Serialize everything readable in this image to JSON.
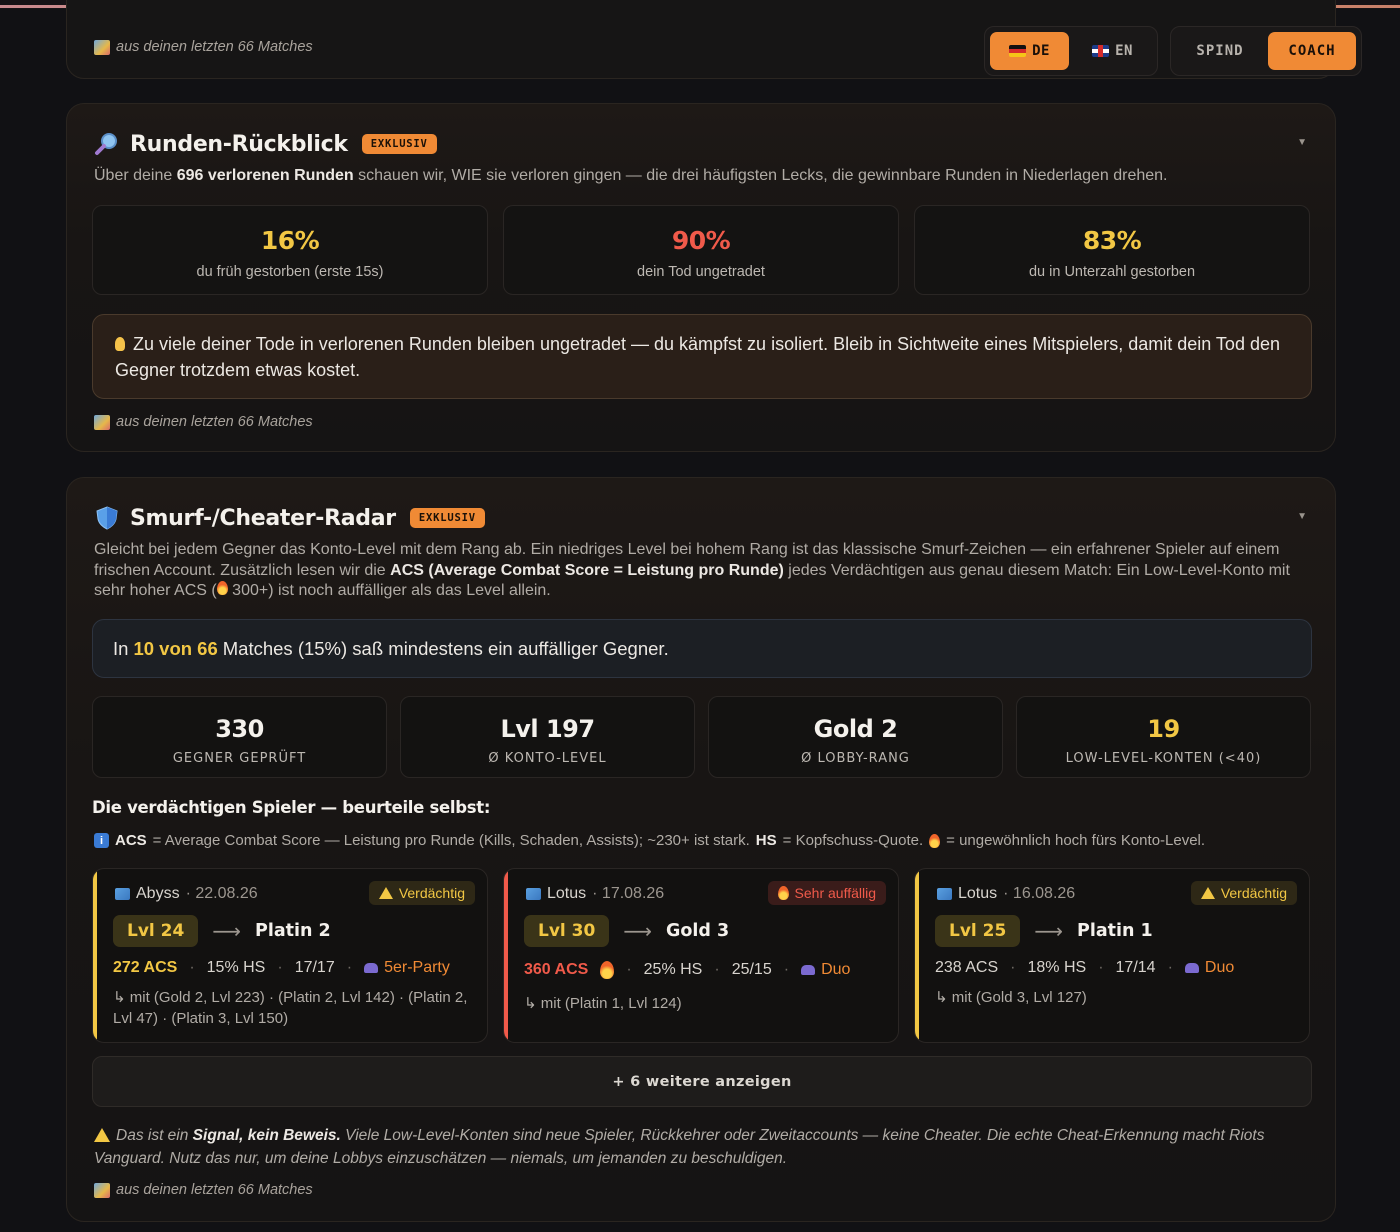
{
  "colors": {
    "accent": "#f08a35",
    "yellow": "#f2c744",
    "red": "#f05a4a"
  },
  "top": {
    "source": "aus deinen letzten 66 Matches"
  },
  "lang": {
    "de": "DE",
    "en": "EN",
    "active": "DE"
  },
  "mode": {
    "spind": "SPIND",
    "coach": "COACH",
    "active": "COACH"
  },
  "review": {
    "title": "Runden-Rückblick",
    "badge": "EXKLUSIV",
    "icon": "magnifier-icon",
    "desc_pre": "Über deine ",
    "desc_bold": "696 verlorenen Runden",
    "desc_post": " schauen wir, WIE sie verloren gingen — die drei häufigsten Lecks, die gewinnbare Runden in Niederlagen drehen.",
    "stats": [
      {
        "value": "16%",
        "label": "du früh gestorben (erste 15s)",
        "color": "#f2c744"
      },
      {
        "value": "90%",
        "label": "dein Tod ungetradet",
        "color": "#f05a4a"
      },
      {
        "value": "83%",
        "label": "du in Unterzahl gestorben",
        "color": "#f2c744"
      }
    ],
    "tip": "Zu viele deiner Tode in verlorenen Runden bleiben ungetradet — du kämpfst zu isoliert. Bleib in Sichtweite eines Mitspielers, damit dein Tod den Gegner trotzdem etwas kostet.",
    "source": "aus deinen letzten 66 Matches"
  },
  "radar": {
    "title": "Smurf-/Cheater-Radar",
    "badge": "EXKLUSIV",
    "icon": "shield-icon",
    "desc_1": "Gleicht bei jedem Gegner das Konto-Level mit dem Rang ab. Ein niedriges Level bei hohem Rang ist das klassische Smurf-Zeichen — ein erfahrener Spieler auf einem frischen Account. Zusätzlich lesen wir die ",
    "desc_bold": "ACS (Average Combat Score = Leistung pro Runde)",
    "desc_2": " jedes Verdächtigen aus genau diesem Match: Ein Low-Level-Konto mit sehr hoher ACS (",
    "desc_3": " 300+) ist noch auffälliger als das Level allein.",
    "info_pre": "In",
    "info_highlight": "10 von 66",
    "info_post": "Matches (15%) saß mindestens ein auffälliger Gegner.",
    "stats": [
      {
        "value": "330",
        "label": "GEGNER GEPRÜFT"
      },
      {
        "value": "Lvl 197",
        "label": "Ø KONTO-LEVEL"
      },
      {
        "value": "Gold 2",
        "label": "Ø LOBBY-RANG"
      },
      {
        "value": "19",
        "label": "LOW-LEVEL-KONTEN (<40)"
      }
    ],
    "subheading": "Die verdächtigen Spieler — beurteile selbst:",
    "legend_a": "ACS",
    "legend_b": " = Average Combat Score — Leistung pro Runde (Kills, Schaden, Assists); ~230+ ist stark. ",
    "legend_c": "HS",
    "legend_d": " = Kopfschuss-Quote.",
    "legend_e": " = ungewöhnlich hoch fürs Konto-Level.",
    "players": [
      {
        "map": "Abyss",
        "date": " · 22.08.26",
        "tag": "Verdächtig",
        "tag_type": "suspicious",
        "level": "Lvl 24",
        "rank": "Platin 2",
        "acs": "272 ACS",
        "hs": "15% HS",
        "kd": "17/17",
        "party": "5er-Party",
        "with": "↳ mit (Gold 2, Lvl 223) · (Platin 2, Lvl 142) · (Platin 2, Lvl 47) · (Platin 3, Lvl 150)",
        "color": "#f2c744"
      },
      {
        "map": "Lotus",
        "date": " · 17.08.26",
        "tag": "Sehr auffällig",
        "tag_type": "highly",
        "level": "Lvl 30",
        "rank": "Gold 3",
        "acs": "360 ACS",
        "hs": "25% HS",
        "kd": "25/15",
        "party": "Duo",
        "with": "↳ mit (Platin 1, Lvl 124)",
        "color": "#f05a4a"
      },
      {
        "map": "Lotus",
        "date": " · 16.08.26",
        "tag": "Verdächtig",
        "tag_type": "suspicious",
        "level": "Lvl 25",
        "rank": "Platin 1",
        "acs": "238 ACS",
        "hs": "18% HS",
        "kd": "17/14",
        "party": "Duo",
        "with": "↳ mit (Gold 3, Lvl 127)",
        "color": "#f2c744"
      }
    ],
    "more": "+ 6 weitere anzeigen",
    "disc_pre": "Das ist ein ",
    "disc_bold": "Signal, kein Beweis.",
    "disc_post": " Viele Low-Level-Konten sind neue Spieler, Rückkehrer oder Zweitaccounts — keine Cheater. Die echte Cheat-Erkennung macht Riots Vanguard. Nutz das nur, um deine Lobbys einzuschätzen — niemals, um jemanden zu beschuldigen.",
    "source": "aus deinen letzten 66 Matches"
  }
}
